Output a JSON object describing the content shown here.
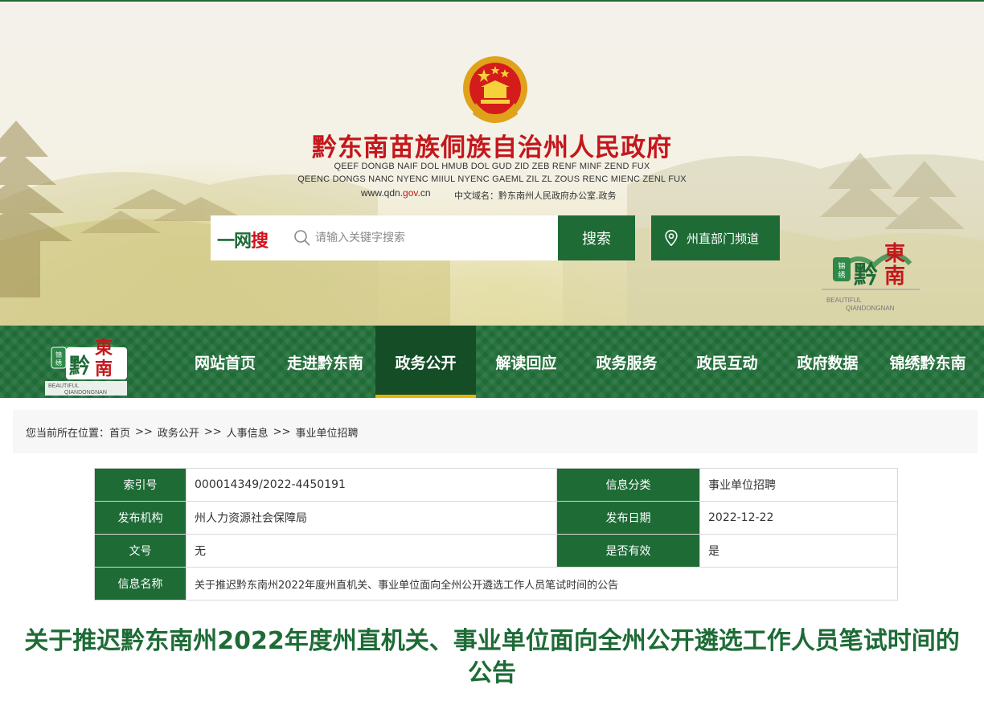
{
  "header": {
    "title": "黔东南苗族侗族自治州人民政府",
    "subtitle_line1": "QEEF DONGB NAIF DOL HMUB DOL GUD ZID ZEB RENF MINF ZEND FUX",
    "subtitle_line2": "QEENC DONGS NANC NYENC MIIUL NYENC GAEML ZIL ZL ZOUS RENC MIENC ZENL FUX",
    "domain_prefix": "www.qdn.",
    "domain_gov": "gov",
    "domain_suffix": ".cn",
    "cn_domain": "中文域名：黔东南州人民政府办公室.政务"
  },
  "search": {
    "brand_prefix": "一网",
    "brand_highlight": "搜",
    "placeholder": "请输入关键字搜索",
    "button_label": "搜索",
    "dept_button_label": "州直部门频道"
  },
  "logo": {
    "text_main": "黔東南",
    "text_side": "锦绣",
    "text_en1": "BEAUTIFUL",
    "text_en2": "QIANDONGNAN"
  },
  "nav": {
    "items": [
      {
        "label": "网站首页",
        "active": false
      },
      {
        "label": "走进黔东南",
        "active": false
      },
      {
        "label": "政务公开",
        "active": true
      },
      {
        "label": "解读回应",
        "active": false
      },
      {
        "label": "政务服务",
        "active": false
      },
      {
        "label": "政民互动",
        "active": false
      },
      {
        "label": "政府数据",
        "active": false
      },
      {
        "label": "锦绣黔东南",
        "active": false
      }
    ]
  },
  "breadcrumb": {
    "prefix": "您当前所在位置：",
    "separator": ">>",
    "items": [
      "首页",
      "政务公开",
      "人事信息",
      "事业单位招聘"
    ]
  },
  "info": {
    "index_label": "索引号",
    "index_value": "000014349/2022-4450191",
    "category_label": "信息分类",
    "category_value": "事业单位招聘",
    "org_label": "发布机构",
    "org_value": "州人力资源社会保障局",
    "date_label": "发布日期",
    "date_value": "2022-12-22",
    "docno_label": "文号",
    "docno_value": "无",
    "valid_label": "是否有效",
    "valid_value": "是",
    "name_label": "信息名称",
    "name_value": "关于推迟黔东南州2022年度州直机关、事业单位面向全州公开遴选工作人员笔试时间的公告"
  },
  "article": {
    "title": "关于推迟黔东南州2022年度州直机关、事业单位面向全州公开遴选工作人员笔试时间的公告"
  },
  "colors": {
    "brand_green": "#1e6b36",
    "title_red": "#c4171c",
    "nav_active_underline": "#e8b400"
  }
}
